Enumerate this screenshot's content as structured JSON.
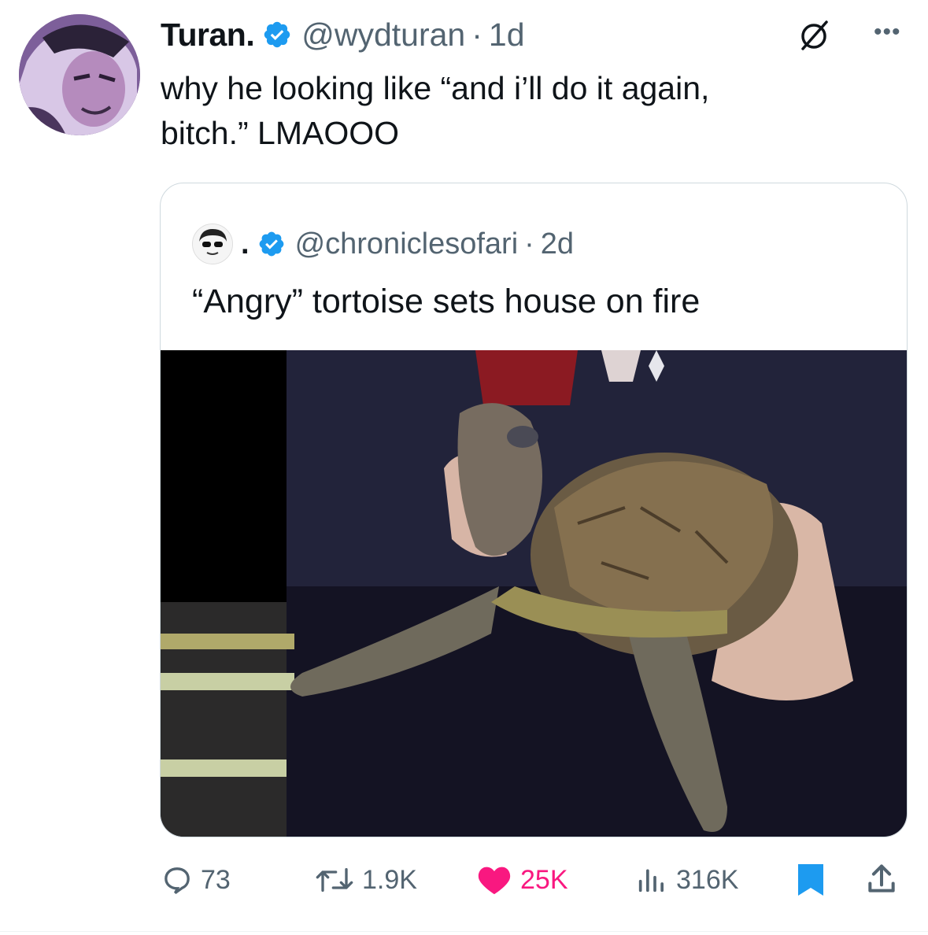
{
  "tweet": {
    "author_name": "Turan.",
    "handle": "@wydturan",
    "separator": "·",
    "time": "1d",
    "more_icon": "more-icon",
    "text_lines": [
      "why he looking like “and i’ll do it again,",
      "bitch.” LMAOOO"
    ]
  },
  "quote": {
    "author_name": ".",
    "handle": "@chroniclesofari",
    "separator": "·",
    "time": "2d",
    "text": "“Angry” tortoise sets house on fire",
    "image": "tortoise-photo"
  },
  "actions": {
    "replies": "73",
    "retweets": "1.9K",
    "likes": "25K",
    "views": "316K"
  },
  "colors": {
    "verified": "#1d9bf0",
    "like": "#f91880",
    "bookmark": "#1d9bf0",
    "secondary_text": "#536471"
  }
}
